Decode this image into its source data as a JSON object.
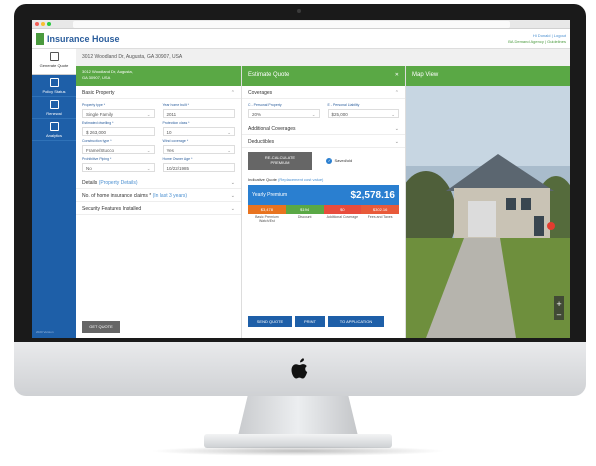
{
  "app": {
    "title": "Insurance House",
    "top_links": [
      "Hi Donald",
      "Logout",
      "BA Demand Agency",
      "Guidelines"
    ]
  },
  "address_bar": "3012 Woodland Dr, Augusta, GA 30907, USA",
  "nav": {
    "quote": "Generate Quote",
    "items": [
      "Policy Status",
      "Renewal",
      "Analytics"
    ],
    "footer": "2020 Version"
  },
  "form": {
    "header_line1": "3012 Woodland Dr, Augusta,",
    "header_line2": "GA 30907, USA",
    "basic_property": "Basic Property",
    "fields": [
      {
        "label": "Property type *",
        "value": "Single Family",
        "dropdown": true
      },
      {
        "label": "Year home built *",
        "value": "2011",
        "dropdown": false
      },
      {
        "label": "Estimated dwelling *",
        "value": "$ 263,000",
        "dropdown": false
      },
      {
        "label": "Protection class *",
        "value": "10",
        "dropdown": true
      },
      {
        "label": "Construction type *",
        "value": "Frame/Stucco",
        "dropdown": true
      },
      {
        "label": "Wind coverage *",
        "value": "Yes",
        "dropdown": true
      },
      {
        "label": "Prohibitive Piping *",
        "value": "No",
        "dropdown": true
      },
      {
        "label": "Home Owner Age *",
        "value": "10/22/1985",
        "dropdown": false
      }
    ],
    "details": "Details",
    "details_link": "(Property Details)",
    "claims": "No. of home insurance claims *",
    "claims_link": "(In last 3 years)",
    "security": "Security Features Installed",
    "get_quote": "GET QUOTE"
  },
  "estimate": {
    "title": "Estimate Quote",
    "coverages": "Coverages",
    "cov_fields": [
      {
        "label": "C - Personal Property",
        "value": "20%"
      },
      {
        "label": "E - Personal Liability",
        "value": "$25,000"
      }
    ],
    "additional": "Additional Coverages",
    "deductibles": "Deductibles",
    "recalc_line1": "RE-CALCULATE",
    "recalc_line2": "PREMIUM",
    "saved": "Saved/old",
    "indicative": "Indicative Quote",
    "indicative_link": "(Replacement cost value)",
    "yearly_label": "Yearly Premium",
    "yearly_amount": "$2,578.16",
    "breakdown": [
      {
        "amount": "$3,478",
        "label": "Basic Premium Watch/Est",
        "color": "#e8731f"
      },
      {
        "amount": "$194",
        "label": "Discount",
        "color": "#5aa845"
      },
      {
        "amount": "$0",
        "label": "Additional Coverage",
        "color": "#e84c3d"
      },
      {
        "amount": "$302.16",
        "label": "Fees and Taxes",
        "color": "#e85a3a"
      }
    ],
    "actions": [
      "SEND QUOTE",
      "PRINT",
      "TO APPLICATION"
    ]
  },
  "map": {
    "title": "Map View"
  }
}
